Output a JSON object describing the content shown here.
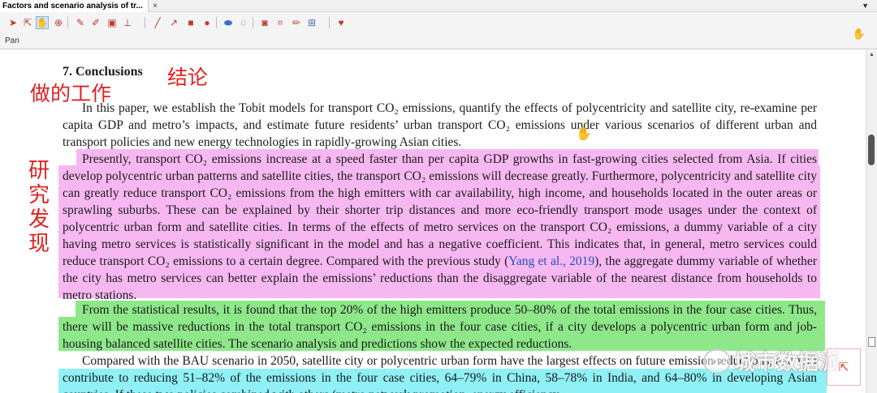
{
  "window": {
    "tab_title": "Factors and scenario analysis of tr...",
    "tab_close": "×",
    "window_menu": "▼"
  },
  "toolbar": {
    "tools": [
      {
        "name": "select-arrow-icon",
        "glyph": "➤",
        "color": "#c0392b"
      },
      {
        "name": "select-text-icon",
        "glyph": "⇱",
        "color": "#c0392b"
      },
      {
        "name": "pan-hand-icon",
        "glyph": "✋",
        "color": "#c0392b"
      },
      {
        "name": "zoom-icon",
        "glyph": "⊕",
        "color": "#c0392b"
      },
      {
        "name": "highlighter-icon",
        "glyph": "✎",
        "color": "#c0392b"
      },
      {
        "name": "pen-icon",
        "glyph": "✐",
        "color": "#c0392b"
      },
      {
        "name": "image-icon",
        "glyph": "▣",
        "color": "#c0392b"
      },
      {
        "name": "stamp-icon",
        "glyph": "⊥",
        "color": "#c0392b"
      },
      {
        "name": "line-icon",
        "glyph": "╱",
        "color": "#c0392b"
      },
      {
        "name": "arrow-icon",
        "glyph": "↗",
        "color": "#c0392b"
      },
      {
        "name": "rectangle-icon",
        "glyph": "■",
        "color": "#c0392b"
      },
      {
        "name": "ellipse-icon",
        "glyph": "●",
        "color": "#c0392b"
      },
      {
        "name": "eraser-icon",
        "glyph": "⬬",
        "color": "#3b6fc9"
      },
      {
        "name": "lasso-icon",
        "glyph": "◌",
        "color": "#c0392b"
      },
      {
        "name": "snapshot-icon",
        "glyph": "◙",
        "color": "#c0392b"
      },
      {
        "name": "crop-icon",
        "glyph": "⌗",
        "color": "#c0392b"
      },
      {
        "name": "ruler-icon",
        "glyph": "✏",
        "color": "#c0392b"
      },
      {
        "name": "insert-image-icon",
        "glyph": "⊞",
        "color": "#3b6fc9"
      },
      {
        "name": "favorite-heart-icon",
        "glyph": "♥",
        "color": "#c0392b"
      }
    ],
    "active_tool_label": "Pan",
    "side_icon": "✋"
  },
  "scrollbar": {
    "up_arrow": "▲"
  },
  "document": {
    "heading": "7.  Conclusions",
    "annotations": {
      "conclusion": "结论",
      "work_done": "做的工作",
      "findings": "研究发现"
    },
    "paragraphs": {
      "p1": "In this paper, we establish the Tobit models for transport CO₂ emissions, quantify the effects of polycentricity and satellite city, re-examine per capita GDP and metro’s impacts, and estimate future residents’ urban transport CO₂ emissions under various scenarios of different urban and transport policies and new energy technologies in rapidly-growing Asian cities.",
      "p2_before_cite": "Presently, transport CO₂ emissions increase at a speed faster than per capita GDP growths in fast-growing cities selected from Asia. If cities develop polycentric urban patterns and satellite cities, the transport CO₂ emissions will decrease greatly. Furthermore, polycentricity and satellite city can greatly reduce transport CO₂ emissions from the high emitters with car availability, high income, and households located in the outer areas or sprawling suburbs. These can be explained by their shorter trip distances and more eco-friendly transport mode usages under the context of polycentric urban form and satellite cities. In terms of the effects of metro services on the transport CO₂ emissions, a dummy variable of a city having metro services is statistically significant in the model and has a negative coefficient. This indicates that, in general, metro services could reduce transport CO₂ emissions to a certain degree. Compared with the previous study (",
      "p2_cite": "Yang et al., 2019",
      "p2_after_cite": "), the aggregate dummy variable of whether the city has metro services can better explain the emissions’ reductions than the disaggregate variable of the nearest distance from households to metro stations.",
      "p3": "From the statistical results, it is found that the top 20% of the high emitters produce 50–80% of the total emissions in the four case cities. Thus, there will be massive reductions in the total transport CO₂ emissions in the four case cities, if a city develops a polycentric urban form and job-housing balanced satellite cities. The scenario analysis and predictions show the expected reductions.",
      "p4": "Compared with the BAU scenario in 2050, satellite city or polycentric urban form have the largest effects on future emission reductions, and will contribute to reducing 51–82% of the emissions in the four case cities, 64–79% in China, 58–78% in India, and 64–80% in developing Asian countries. If these two policies combined with others (metro network promotion, energy efficiency"
    },
    "colors": {
      "pink_highlight": "#f7b8f2",
      "green_highlight": "#8ee88a",
      "cyan_highlight": "#8ff1f6",
      "annotation_red": "#e02020",
      "citation_blue": "#1f4fbf"
    }
  },
  "overlay": {
    "cursor": "✋",
    "watermark_icon": "◕◕",
    "watermark_text": "城市数据派",
    "corner_button": "⇱"
  }
}
